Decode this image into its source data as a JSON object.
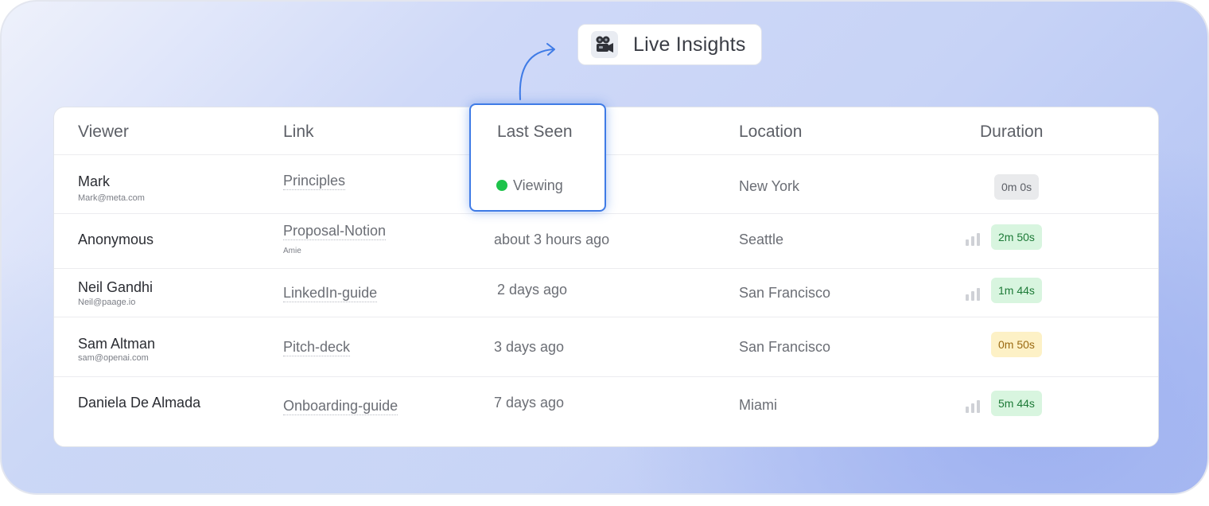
{
  "badge": {
    "label": "Live Insights",
    "icon": "movie-camera-icon"
  },
  "table": {
    "headers": {
      "viewer": "Viewer",
      "link": "Link",
      "last_seen": "Last Seen",
      "location": "Location",
      "duration": "Duration"
    },
    "rows": [
      {
        "name": "Mark",
        "email": "Mark@meta.com",
        "link": "Principles",
        "link_sub": "",
        "last_seen": "Viewing",
        "location": "New York",
        "duration": "0m 0s",
        "duration_status": "gray",
        "signal": false
      },
      {
        "name": "Anonymous",
        "email": "",
        "link": "Proposal-Notion",
        "link_sub": "Amie",
        "last_seen": "about 3 hours ago",
        "location": "Seattle",
        "duration": "2m 50s",
        "duration_status": "green",
        "signal": true
      },
      {
        "name": "Neil Gandhi",
        "email": "Neil@paage.io",
        "link": "LinkedIn-guide",
        "link_sub": "",
        "last_seen": "2 days ago",
        "location": "San Francisco",
        "duration": "1m 44s",
        "duration_status": "green",
        "signal": true
      },
      {
        "name": "Sam Altman",
        "email": "sam@openai.com",
        "link": "Pitch-deck",
        "link_sub": "",
        "last_seen": "3 days ago",
        "location": "San Francisco",
        "duration": "0m 50s",
        "duration_status": "amber",
        "signal": false
      },
      {
        "name": "Daniela De Almada",
        "email": "",
        "link": "Onboarding-guide",
        "link_sub": "",
        "last_seen": "7 days ago",
        "location": "Miami",
        "duration": "5m 44s",
        "duration_status": "green",
        "signal": true
      }
    ]
  },
  "colors": {
    "highlight_border": "#3f7be6",
    "live_dot": "#1ec34b",
    "green_badge_bg": "#d8f5df",
    "green_badge_text": "#1d7a37",
    "amber_badge_bg": "#fdf1c6",
    "amber_badge_text": "#9a6a12"
  }
}
